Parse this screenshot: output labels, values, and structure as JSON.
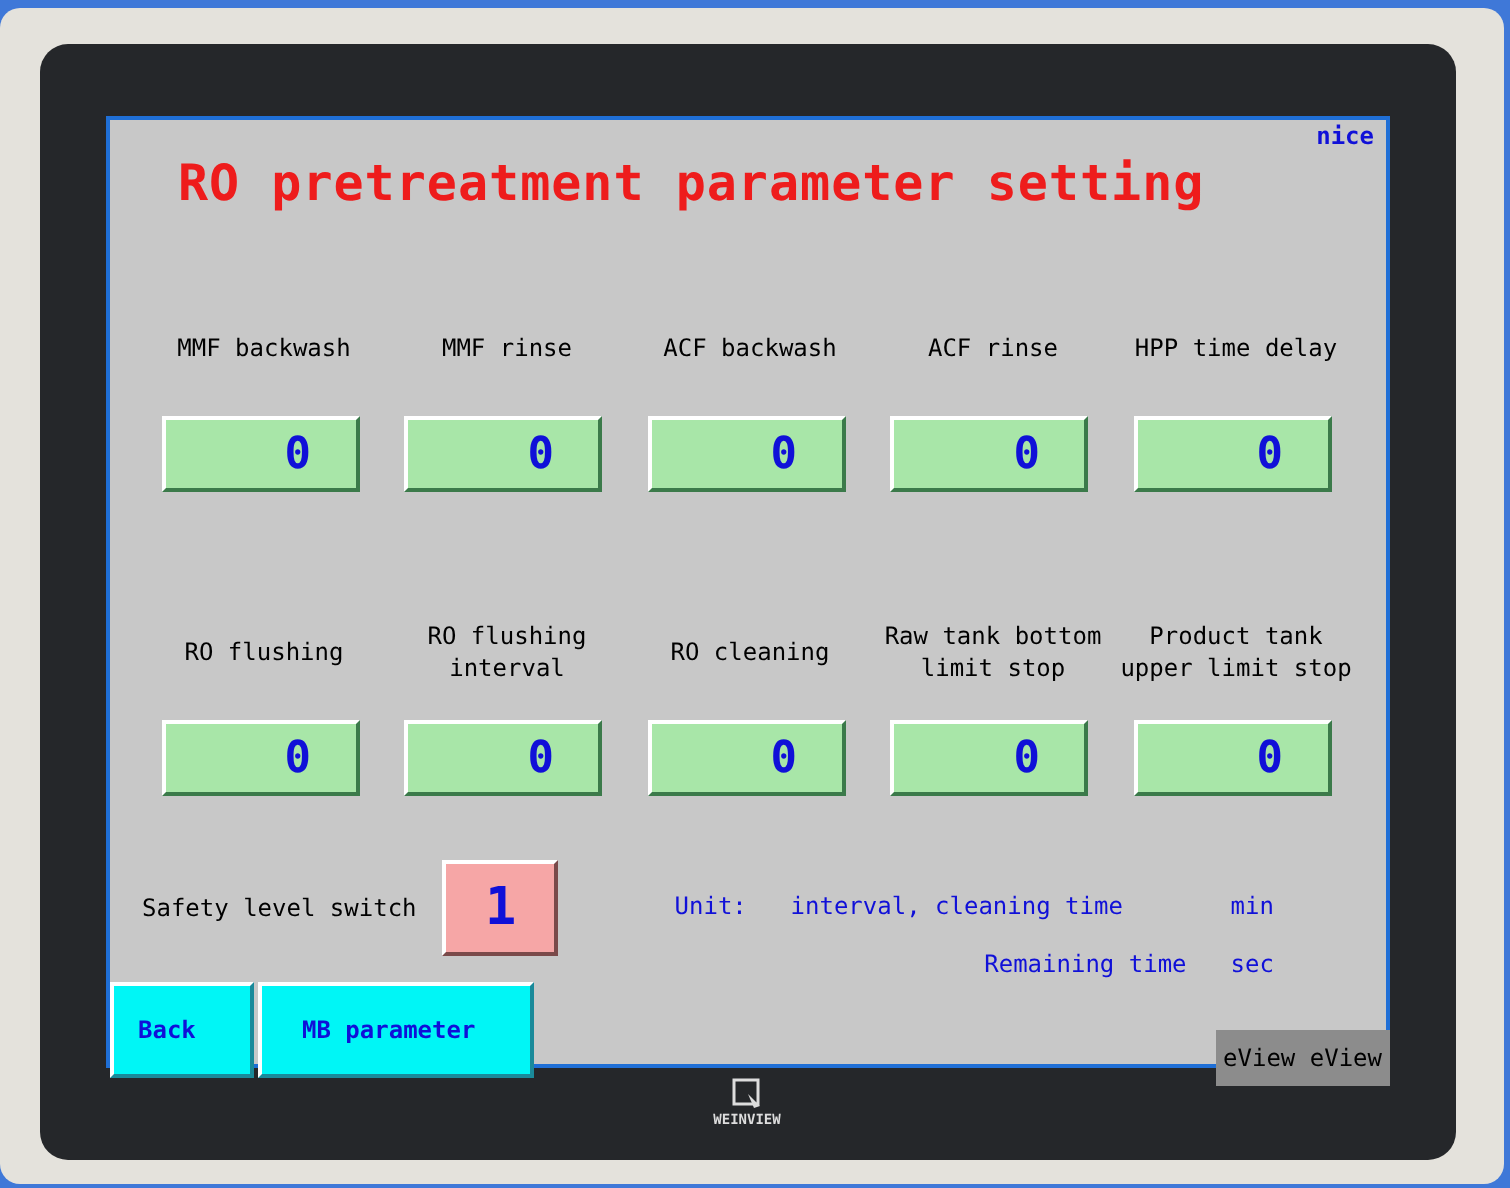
{
  "corner_label": "nice",
  "title": "RO pretreatment parameter setting",
  "parameter_rows": [
    [
      {
        "label": "MMF backwash",
        "value": "0"
      },
      {
        "label": "MMF rinse",
        "value": "0"
      },
      {
        "label": "ACF backwash",
        "value": "0"
      },
      {
        "label": "ACF rinse",
        "value": "0"
      },
      {
        "label": "HPP time delay",
        "value": "0"
      }
    ],
    [
      {
        "label": "RO flushing",
        "value": "0"
      },
      {
        "label": "RO flushing interval",
        "value": "0"
      },
      {
        "label": "RO cleaning",
        "value": "0"
      },
      {
        "label": "Raw tank bottom limit stop",
        "value": "0"
      },
      {
        "label": "Product tank upper limit stop",
        "value": "0"
      }
    ]
  ],
  "safety": {
    "label": "Safety level switch",
    "value": "1",
    "on": true
  },
  "units": {
    "heading": "Unit:",
    "rows": [
      {
        "label": "interval, cleaning time",
        "unit": "min"
      },
      {
        "label": "Remaining time",
        "unit": "sec"
      }
    ]
  },
  "buttons": [
    "Back",
    "MB parameter"
  ],
  "badge": "eView eView",
  "brand": "WEINVIEW"
}
